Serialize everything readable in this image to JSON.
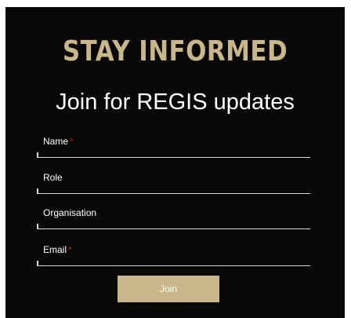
{
  "signup": {
    "headline": "STAY INFORMED",
    "subheadline": "Join for REGIS updates",
    "fields": [
      {
        "label": "Name",
        "required_mark": "*",
        "value": ""
      },
      {
        "label": "Role",
        "required_mark": "",
        "value": ""
      },
      {
        "label": "Organisation",
        "required_mark": "",
        "value": ""
      },
      {
        "label": "Email",
        "required_mark": "*",
        "value": ""
      }
    ],
    "submit_label": "Join"
  },
  "colors": {
    "panel_background": "#080808",
    "accent_gold": "#c9b68a",
    "required_red": "#c81e1e",
    "text": "#ffffff",
    "underline": "#d8d8d8"
  }
}
